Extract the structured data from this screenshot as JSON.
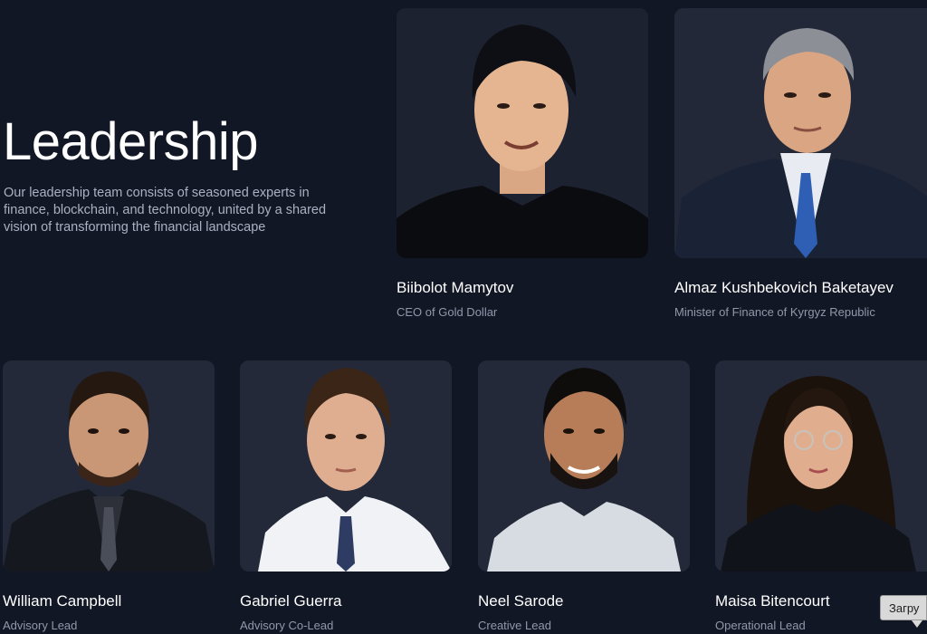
{
  "section": {
    "title": "Leadership",
    "description": "Our leadership team consists of seasoned experts in finance, blockchain, and technology, united by a shared vision of transforming the financial landscape"
  },
  "leaders": [
    {
      "name": "Biibolot Mamytov",
      "role": "CEO of Gold Dollar"
    },
    {
      "name": "Almaz Kushbekovich Baketayev",
      "role": "Minister of Finance of Kyrgyz Republic"
    },
    {
      "name": "William Campbell",
      "role": "Advisory Lead"
    },
    {
      "name": "Gabriel Guerra",
      "role": "Advisory Co-Lead"
    },
    {
      "name": "Neel Sarode",
      "role": "Creative Lead"
    },
    {
      "name": "Maisa Bitencourt",
      "role": "Operational Lead"
    }
  ],
  "tooltip": {
    "text": "Загру"
  },
  "colors": {
    "background": "#121725",
    "card": "#202637",
    "name": "#ffffff",
    "role": "#9098aa"
  }
}
